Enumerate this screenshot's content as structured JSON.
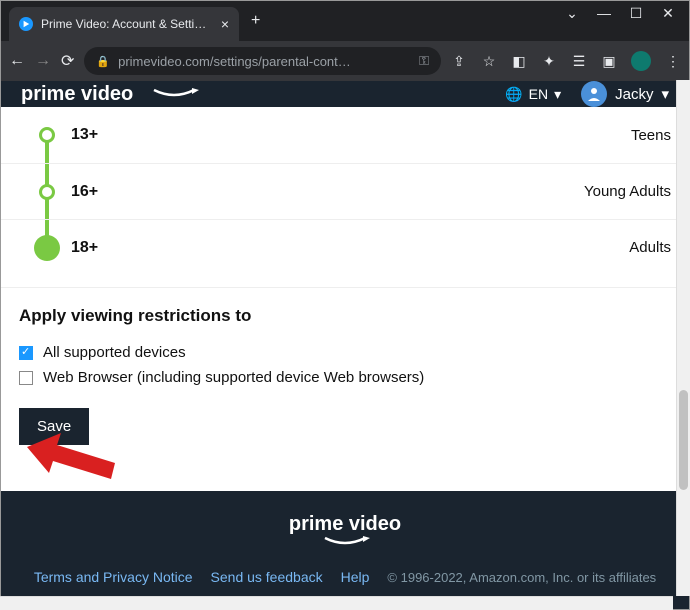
{
  "browser": {
    "tab_title": "Prime Video: Account & Settings",
    "url_display": "primevideo.com/settings/parental-cont…"
  },
  "header": {
    "logo": "prime video",
    "lang": "EN",
    "username": "Jacky"
  },
  "ratings": [
    {
      "label": "13+",
      "category": "Teens",
      "selected": false,
      "firstVisible": true
    },
    {
      "label": "16+",
      "category": "Young Adults",
      "selected": false
    },
    {
      "label": "18+",
      "category": "Adults",
      "selected": true
    }
  ],
  "restrictions": {
    "heading": "Apply viewing restrictions to",
    "options": [
      {
        "label": "All supported devices",
        "checked": true
      },
      {
        "label": "Web Browser (including supported device Web browsers)",
        "checked": false
      }
    ],
    "save_label": "Save"
  },
  "footer": {
    "logo": "prime video",
    "links": [
      "Terms and Privacy Notice",
      "Send us feedback",
      "Help"
    ],
    "copyright": "© 1996-2022, Amazon.com, Inc. or its affiliates"
  }
}
